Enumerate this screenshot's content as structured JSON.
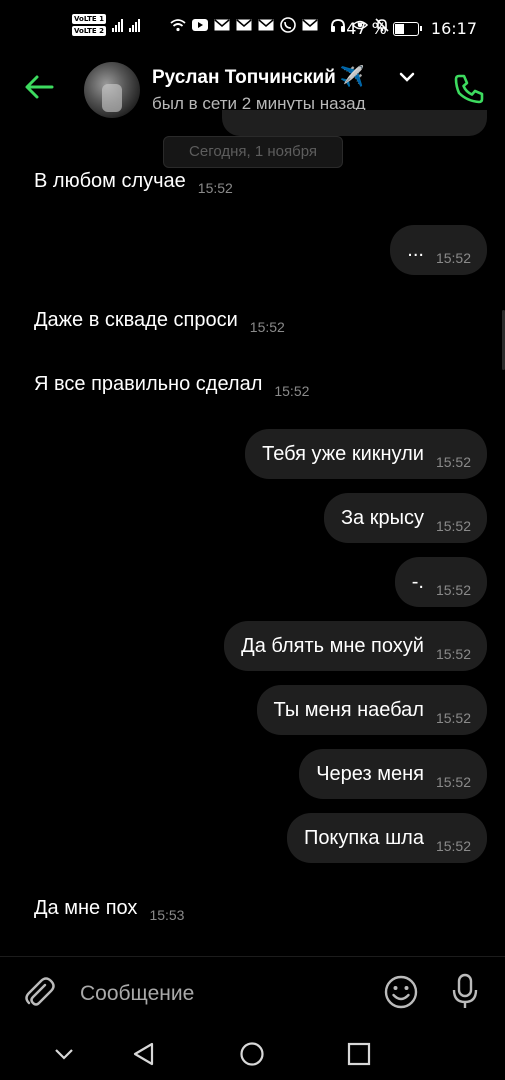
{
  "status_bar": {
    "volte": [
      "VoLTE 1",
      "VoLTE 2"
    ],
    "battery_percent": "47 %",
    "battery_level": 0.47,
    "time": "16:17",
    "icons": [
      "wifi-icon",
      "youtube-icon",
      "mail-icon",
      "mail-icon",
      "mail-icon",
      "viber-icon",
      "mail-icon",
      "headphones-icon",
      "eye-icon",
      "mute-bell-icon"
    ]
  },
  "header": {
    "contact_name": "Руслан Топчинский",
    "name_emoji": "✈️",
    "last_seen": "был в сети 2 минуты назад"
  },
  "date_separator": "Сегодня, 1 ноября",
  "messages": [
    {
      "direction": "in",
      "text": "В любом случае",
      "time": "15:52"
    },
    {
      "direction": "out",
      "text": "...",
      "time": "15:52"
    },
    {
      "direction": "in",
      "text": "Даже в скваде спроси",
      "time": "15:52"
    },
    {
      "direction": "in",
      "text": "Я все правильно сделал",
      "time": "15:52"
    },
    {
      "direction": "out",
      "text": "Тебя уже кикнули",
      "time": "15:52"
    },
    {
      "direction": "out",
      "text": "За крысу",
      "time": "15:52"
    },
    {
      "direction": "out",
      "text": "-.",
      "time": "15:52"
    },
    {
      "direction": "out",
      "text": "Да блять мне похуй",
      "time": "15:52"
    },
    {
      "direction": "out",
      "text": "Ты меня наебал",
      "time": "15:52"
    },
    {
      "direction": "out",
      "text": "Через меня",
      "time": "15:52"
    },
    {
      "direction": "out",
      "text": "Покупка шла",
      "time": "15:52"
    },
    {
      "direction": "in",
      "text": "Да мне пох",
      "time": "15:53"
    }
  ],
  "composer": {
    "placeholder": "Сообщение"
  },
  "colors": {
    "accent": "#3ddb5f",
    "bubble": "#1f1f1f",
    "background": "#000000"
  }
}
